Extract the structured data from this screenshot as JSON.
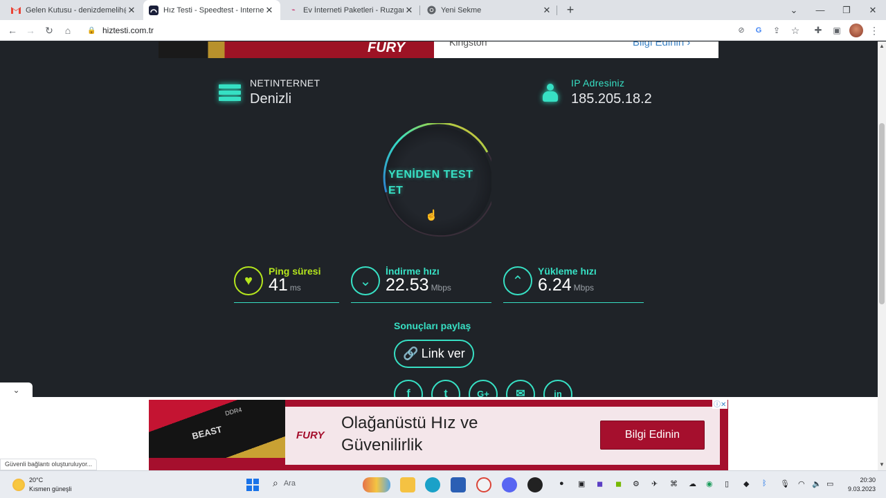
{
  "browser": {
    "tabs": [
      {
        "title": "Gelen Kutusu - denizdemelih@g",
        "icon": "gmail-icon"
      },
      {
        "title": "Hız Testi - Speedtest - Internet H",
        "icon": "speedtest-icon"
      },
      {
        "title": "Ev İnterneti Paketleri - Ruzgar Ne",
        "icon": "ruzgar-icon"
      },
      {
        "title": "Yeni Sekme",
        "icon": "chrome-icon"
      }
    ],
    "url": "hiztesti.com.tr"
  },
  "top_ad": {
    "brand": "FURY",
    "company": "Kingston",
    "cta": "Bilgi Edinin"
  },
  "isp": {
    "label": "NETINTERNET",
    "city": "Denizli"
  },
  "ip": {
    "label": "IP Adresiniz",
    "value": "185.205.18.2"
  },
  "retest_label": "YENİDEN TEST ET",
  "metrics": {
    "ping": {
      "label": "Ping süresi",
      "value": "41",
      "unit": "ms"
    },
    "download": {
      "label": "İndirme hızı",
      "value": "22.53",
      "unit": "Mbps"
    },
    "upload": {
      "label": "Yükleme hızı",
      "value": "6.24",
      "unit": "Mbps"
    }
  },
  "share": {
    "title": "Sonuçları paylaş",
    "link_button": "Link ver",
    "networks": [
      "facebook-icon",
      "twitter-icon",
      "google-plus-icon",
      "email-icon",
      "linkedin-icon"
    ]
  },
  "bottom_ad": {
    "ram_brand": "BEAST",
    "ram_type": "DDR4",
    "brand": "FURY",
    "headline": "Olağanüstü Hız ve Güvenilirlik",
    "cta": "Bilgi Edinin"
  },
  "status_bar": "Güvenli bağlantı oluşturuluyor...",
  "taskbar": {
    "weather_temp": "20°C",
    "weather_desc": "Kısmen güneşli",
    "search": "Ara",
    "time": "20:30",
    "date": "9.03.2023"
  },
  "colors": {
    "accent": "#37e0c4",
    "ping": "#b5e61d",
    "ad_red": "#a50f2d",
    "page_bg": "#1f2328"
  }
}
